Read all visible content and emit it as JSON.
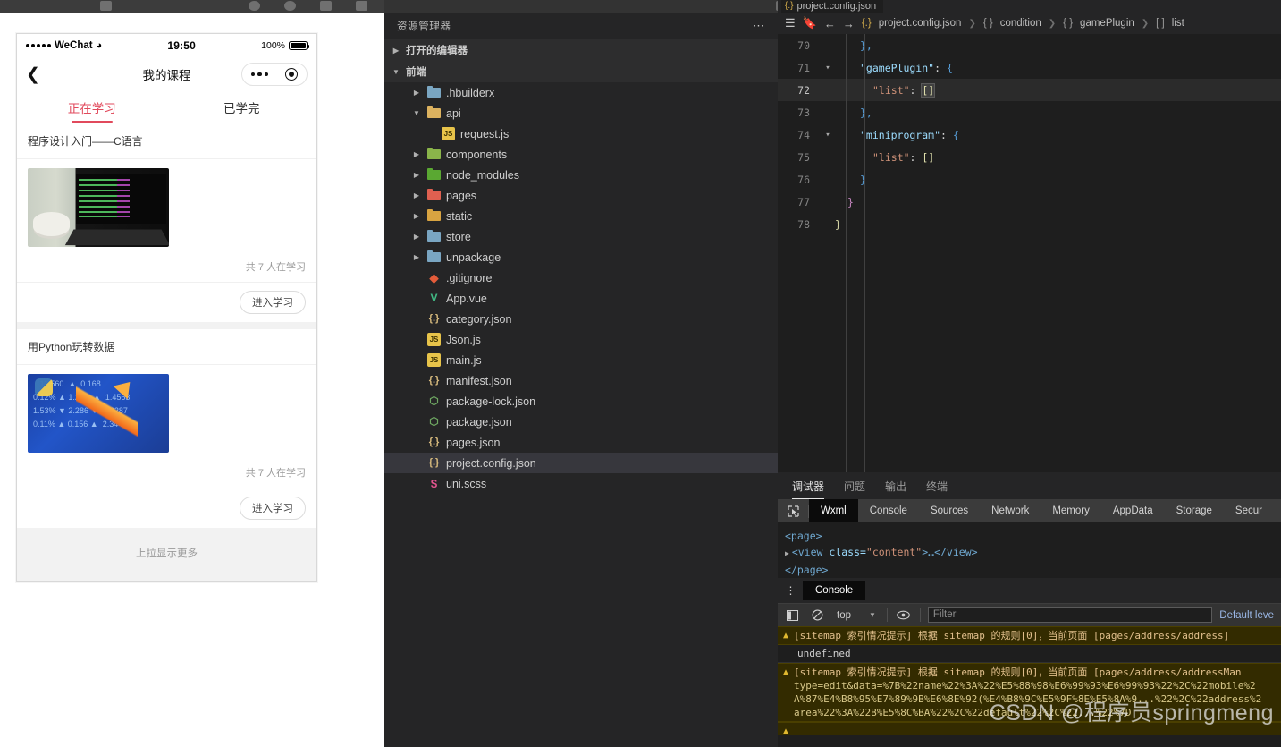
{
  "window": {
    "editor_tab_label": "project.config.json"
  },
  "simulator": {
    "status_bar": {
      "carrier": "WeChat",
      "time": "19:50",
      "battery_pct": "100%"
    },
    "nav": {
      "back_icon": "chevron-left-icon",
      "title": "我的课程"
    },
    "tabs": [
      {
        "label": "正在学习",
        "active": true
      },
      {
        "label": "已学完",
        "active": false
      }
    ],
    "accent_color": "#e14a5c",
    "courses": [
      {
        "title": "程序设计入门——C语言",
        "learners": "共 7 人在学习",
        "action": "进入学习"
      },
      {
        "title": "用Python玩转数据",
        "learners": "共 7 人在学习",
        "action": "进入学习"
      }
    ],
    "load_more": "上拉显示更多"
  },
  "explorer": {
    "title": "资源管理器",
    "more_icon": "ellipsis-icon",
    "sections": [
      {
        "label": "打开的编辑器",
        "expanded": false
      },
      {
        "label": "前端",
        "expanded": true
      }
    ],
    "tree": [
      {
        "name": ".hbuilderx",
        "type": "folder",
        "indent": 1,
        "expanded": false,
        "color": "blue"
      },
      {
        "name": "api",
        "type": "folder",
        "indent": 1,
        "expanded": true,
        "color": "yellow"
      },
      {
        "name": "request.js",
        "type": "js",
        "indent": 2
      },
      {
        "name": "components",
        "type": "folder",
        "indent": 1,
        "expanded": false,
        "color": "green"
      },
      {
        "name": "node_modules",
        "type": "folder",
        "indent": 1,
        "expanded": false,
        "color": "green2"
      },
      {
        "name": "pages",
        "type": "folder",
        "indent": 1,
        "expanded": false,
        "color": "red"
      },
      {
        "name": "static",
        "type": "folder",
        "indent": 1,
        "expanded": false,
        "color": "orange"
      },
      {
        "name": "store",
        "type": "folder",
        "indent": 1,
        "expanded": false,
        "color": "blue"
      },
      {
        "name": "unpackage",
        "type": "folder",
        "indent": 1,
        "expanded": false,
        "color": "blue"
      },
      {
        "name": ".gitignore",
        "type": "git",
        "indent": 1
      },
      {
        "name": "App.vue",
        "type": "vue",
        "indent": 1
      },
      {
        "name": "category.json",
        "type": "json",
        "indent": 1
      },
      {
        "name": "Json.js",
        "type": "js",
        "indent": 1
      },
      {
        "name": "main.js",
        "type": "js",
        "indent": 1
      },
      {
        "name": "manifest.json",
        "type": "json",
        "indent": 1
      },
      {
        "name": "package-lock.json",
        "type": "npm",
        "indent": 1
      },
      {
        "name": "package.json",
        "type": "npm",
        "indent": 1
      },
      {
        "name": "pages.json",
        "type": "json",
        "indent": 1
      },
      {
        "name": "project.config.json",
        "type": "json",
        "indent": 1,
        "selected": true
      },
      {
        "name": "uni.scss",
        "type": "scss",
        "indent": 1
      }
    ]
  },
  "breadcrumb": {
    "menu_icon": "hamburger-menu-icon",
    "bookmark_icon": "bookmark-icon",
    "back_icon": "arrow-left-icon",
    "forward_icon": "arrow-right-icon",
    "parts": [
      {
        "prefix": "{.}",
        "label": "project.config.json"
      },
      {
        "prefix": "{ }",
        "label": "condition"
      },
      {
        "prefix": "{ }",
        "label": "gamePlugin"
      },
      {
        "prefix": "[ ]",
        "label": "list"
      }
    ]
  },
  "code": {
    "lines": [
      {
        "no": "70",
        "fold": "",
        "indent": 2,
        "current": false,
        "tokens": [
          {
            "t": "},",
            "c": "t-br-b"
          }
        ]
      },
      {
        "no": "71",
        "fold": "v",
        "indent": 2,
        "current": false,
        "tokens": [
          {
            "t": "\"gamePlugin\"",
            "c": "t-key"
          },
          {
            "t": ": ",
            "c": "t-pun"
          },
          {
            "t": "{",
            "c": "t-br-b"
          }
        ]
      },
      {
        "no": "72",
        "fold": "",
        "indent": 3,
        "current": true,
        "tokens": [
          {
            "t": "\"list\"",
            "c": "t-key2"
          },
          {
            "t": ": ",
            "c": "t-pun"
          },
          {
            "t": "[]",
            "c": "t-br-y sel-brackets"
          }
        ]
      },
      {
        "no": "73",
        "fold": "",
        "indent": 2,
        "current": false,
        "tokens": [
          {
            "t": "},",
            "c": "t-br-b"
          }
        ]
      },
      {
        "no": "74",
        "fold": "v",
        "indent": 2,
        "current": false,
        "tokens": [
          {
            "t": "\"miniprogram\"",
            "c": "t-key"
          },
          {
            "t": ": ",
            "c": "t-pun"
          },
          {
            "t": "{",
            "c": "t-br-b"
          }
        ]
      },
      {
        "no": "75",
        "fold": "",
        "indent": 3,
        "current": false,
        "tokens": [
          {
            "t": "\"list\"",
            "c": "t-key2"
          },
          {
            "t": ": ",
            "c": "t-pun"
          },
          {
            "t": "[]",
            "c": "t-br-y"
          }
        ]
      },
      {
        "no": "76",
        "fold": "",
        "indent": 2,
        "current": false,
        "tokens": [
          {
            "t": "}",
            "c": "t-br-b"
          }
        ]
      },
      {
        "no": "77",
        "fold": "",
        "indent": 1,
        "current": false,
        "tokens": [
          {
            "t": "}",
            "c": "t-br-m"
          }
        ]
      },
      {
        "no": "78",
        "fold": "",
        "indent": 0,
        "current": false,
        "tokens": [
          {
            "t": "}",
            "c": "t-br-y"
          }
        ]
      }
    ]
  },
  "panel": {
    "cn_tabs": [
      {
        "label": "调试器",
        "active": true
      },
      {
        "label": "问题",
        "active": false
      },
      {
        "label": "输出",
        "active": false
      },
      {
        "label": "终端",
        "active": false
      }
    ],
    "inspect_icon": "cursor-select-icon",
    "devtools_tabs": [
      {
        "label": "Wxml",
        "active": true
      },
      {
        "label": "Console",
        "active": false
      },
      {
        "label": "Sources",
        "active": false
      },
      {
        "label": "Network",
        "active": false
      },
      {
        "label": "Memory",
        "active": false
      },
      {
        "label": "AppData",
        "active": false
      },
      {
        "label": "Storage",
        "active": false
      },
      {
        "label": "Secur",
        "active": false
      }
    ],
    "wxml": {
      "line1": "<page>",
      "line2_tag_open": "<view ",
      "line2_attr": "class=",
      "line2_val": "\"content\"",
      "line2_tail": ">…</view>",
      "line3": "</page>"
    }
  },
  "console": {
    "kebab_icon": "kebab-menu-icon",
    "tab_label": "Console",
    "sidebar_icon": "show-sidebar-icon",
    "clear_icon": "clear-console-icon",
    "context": "top",
    "caret_icon": "chevron-down-icon",
    "eye_icon": "eye-icon",
    "filter_placeholder": "Filter",
    "level_label": "Default leve",
    "messages": [
      {
        "type": "warning",
        "icon": "warning-triangle-icon",
        "text": "[sitemap 索引情况提示] 根据 sitemap 的规则[0]，当前页面 [pages/address/address] ",
        "sub": "undefined"
      },
      {
        "type": "warning",
        "icon": "warning-triangle-icon",
        "text": "[sitemap 索引情况提示] 根据 sitemap 的规则[0]，当前页面 [pages/address/addressMan",
        "encoded": [
          "type=edit&data=%7B%22name%22%3A%22%E5%88%98%E6%99%93%E6%99%93%22%2C%22mobile%2",
          "A%87%E4%B8%95%E7%89%9B%E6%8E%92(%E4%B8%9C%E5%9F%8E%E5%8A%9...%22%2C%22address%2",
          "area%22%3A%22B%E5%8C%BA%22%2C%22default%22%2C%22...%22%7D"
        ]
      }
    ],
    "watermark": "CSDN @程序员springmeng"
  }
}
